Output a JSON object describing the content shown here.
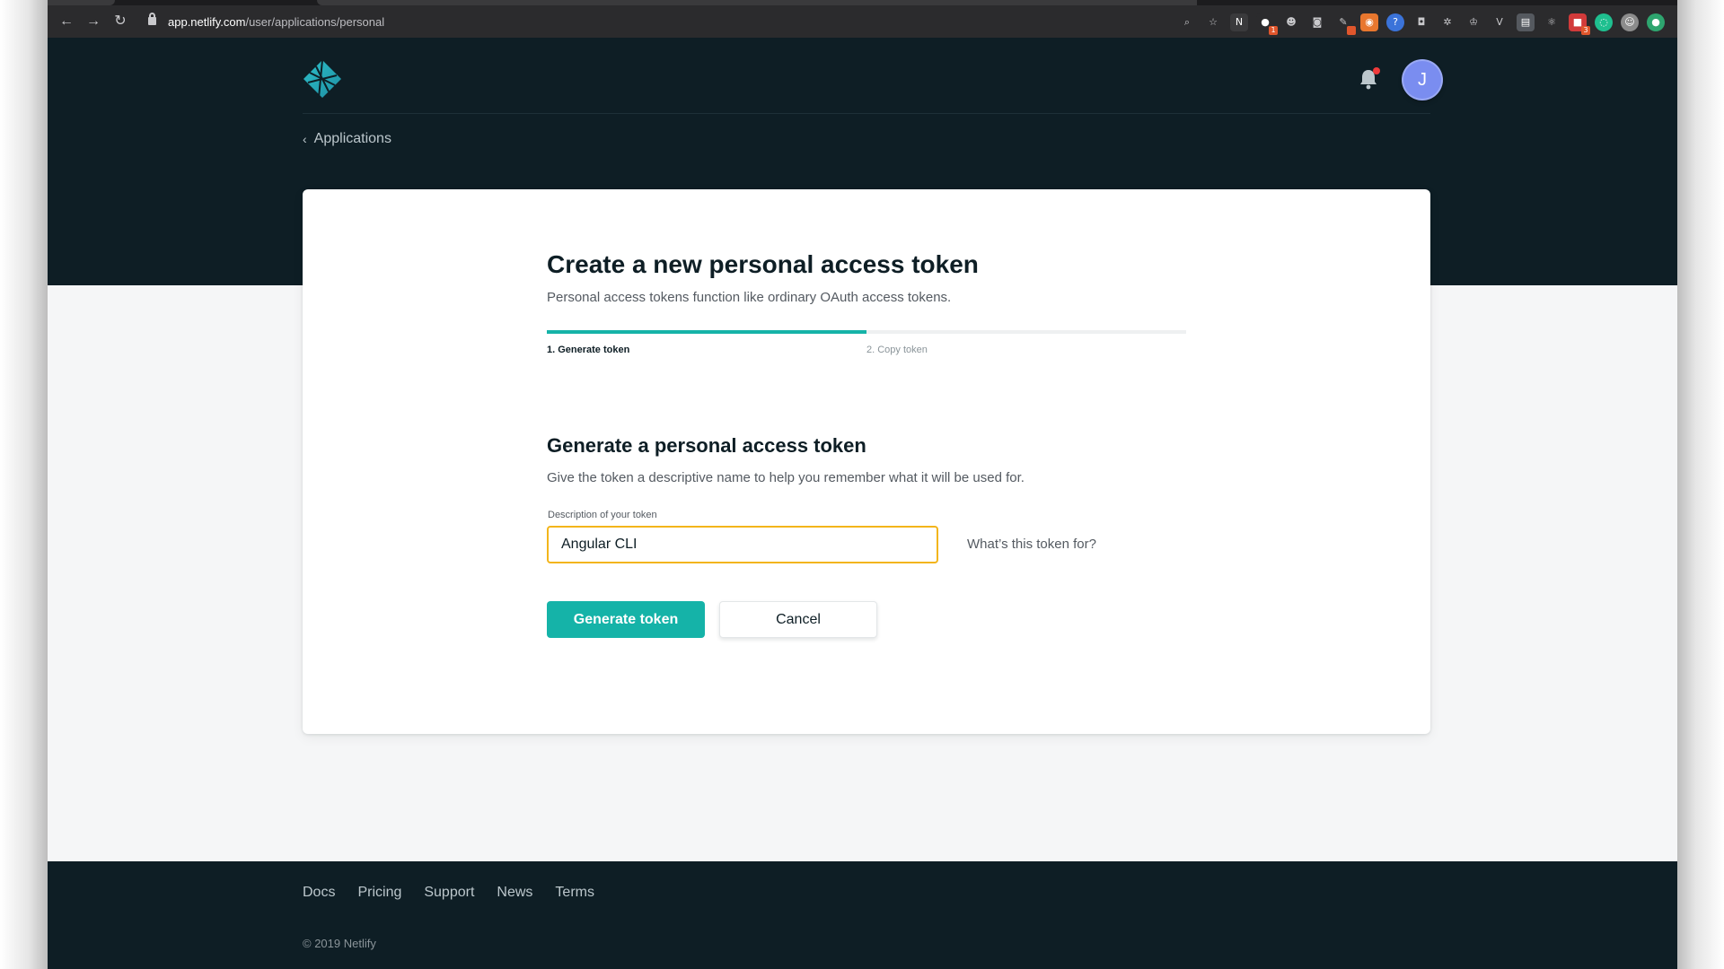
{
  "browser": {
    "url_host": "app.netlify.com",
    "url_path": "/user/applications/personal",
    "extensions": [
      {
        "icon": "zoom-icon",
        "color": "transparent",
        "glyph": "⌕"
      },
      {
        "icon": "bookmark-star-icon",
        "color": "transparent",
        "glyph": "☆"
      },
      {
        "icon": "notion-icon",
        "color": "#3a3a3c",
        "glyph": "N"
      },
      {
        "icon": "chat-bubbles-icon",
        "color": "#2b2b2d",
        "glyph": "●",
        "badge": "1"
      },
      {
        "icon": "reddit-icon",
        "color": "transparent",
        "glyph": "☻"
      },
      {
        "icon": "camera-icon",
        "color": "transparent",
        "glyph": "◙"
      },
      {
        "icon": "pen-icon",
        "color": "transparent",
        "glyph": "✎",
        "badge": " "
      },
      {
        "icon": "rss-icon",
        "color": "#e8772e",
        "glyph": "◉"
      },
      {
        "icon": "blue-circle-icon",
        "color": "#3b73d9",
        "glyph": "?"
      },
      {
        "icon": "screenshot-icon",
        "color": "transparent",
        "glyph": "◘"
      },
      {
        "icon": "gear-icon",
        "color": "transparent",
        "glyph": "✲"
      },
      {
        "icon": "crown-icon",
        "color": "transparent",
        "glyph": "♔"
      },
      {
        "icon": "vue-icon",
        "color": "transparent",
        "glyph": "V"
      },
      {
        "icon": "reader-icon",
        "color": "#55595f",
        "glyph": "▤"
      },
      {
        "icon": "react-icon",
        "color": "transparent",
        "glyph": "⚛"
      },
      {
        "icon": "red-tag-icon",
        "color": "#d23a3a",
        "glyph": "■",
        "badge": "3"
      },
      {
        "icon": "green-circle-icon",
        "color": "#1fbf8f",
        "glyph": "◌"
      },
      {
        "icon": "profile-photo-icon",
        "color": "#8c8c8c",
        "glyph": "☺"
      },
      {
        "icon": "grammarly-icon",
        "color": "#2ea56f",
        "glyph": "●"
      }
    ]
  },
  "header": {
    "logo_name": "netlify-logo",
    "avatar_initial": "J",
    "back_label": "Applications"
  },
  "card": {
    "title": "Create a new personal access token",
    "subtitle": "Personal access tokens function like ordinary OAuth access tokens.",
    "steps": [
      {
        "label": "1. Generate token",
        "active": true
      },
      {
        "label": "2. Copy token",
        "active": false
      }
    ],
    "progress_fraction": 0.5,
    "section_title": "Generate a personal access token",
    "section_desc": "Give the token a descriptive name to help you remember what it will be used for.",
    "field_label": "Description of your token",
    "field_value": "Angular CLI",
    "help_link": "What’s this token for?",
    "generate_label": "Generate token",
    "cancel_label": "Cancel"
  },
  "footer": {
    "links": [
      "Docs",
      "Pricing",
      "Support",
      "News",
      "Terms"
    ],
    "copyright": "© 2019 Netlify"
  },
  "colors": {
    "dark_bg": "#0e1e25",
    "accent": "#15b3a8",
    "input_focus": "#f3b51b",
    "avatar": "#7a8df0"
  }
}
